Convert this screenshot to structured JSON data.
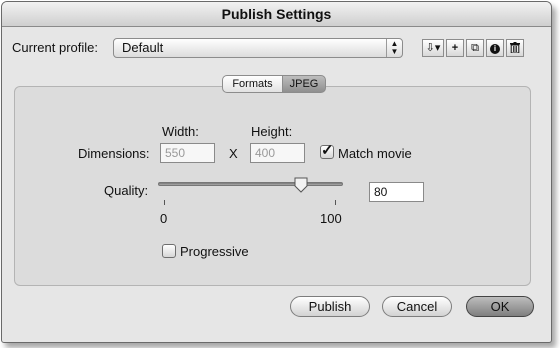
{
  "window": {
    "title": "Publish Settings"
  },
  "profile": {
    "label": "Current profile:",
    "value": "Default",
    "arrows": "▲▼",
    "toolbar": [
      {
        "icon": "import-export-icon",
        "glyph": "⇩"
      },
      {
        "icon": "add-icon",
        "glyph": "+"
      },
      {
        "icon": "duplicate-icon",
        "glyph": "⧉"
      },
      {
        "icon": "info-icon",
        "glyph": "i"
      },
      {
        "icon": "trash-icon",
        "glyph": "🗑"
      }
    ]
  },
  "tabs": [
    {
      "label": "Formats",
      "selected": false
    },
    {
      "label": "JPEG",
      "selected": true
    }
  ],
  "jpeg": {
    "dimensions_label": "Dimensions:",
    "width_label": "Width:",
    "width_value": "550",
    "x_label": "X",
    "height_label": "Height:",
    "height_value": "400",
    "match_movie_label": "Match movie",
    "match_movie_checked": true,
    "quality_label": "Quality:",
    "quality_value": "80",
    "quality_min": "0",
    "quality_max": "100",
    "quality_level": 80,
    "progressive_label": "Progressive",
    "progressive_checked": false
  },
  "buttons": {
    "publish": "Publish",
    "cancel": "Cancel",
    "ok": "OK"
  }
}
